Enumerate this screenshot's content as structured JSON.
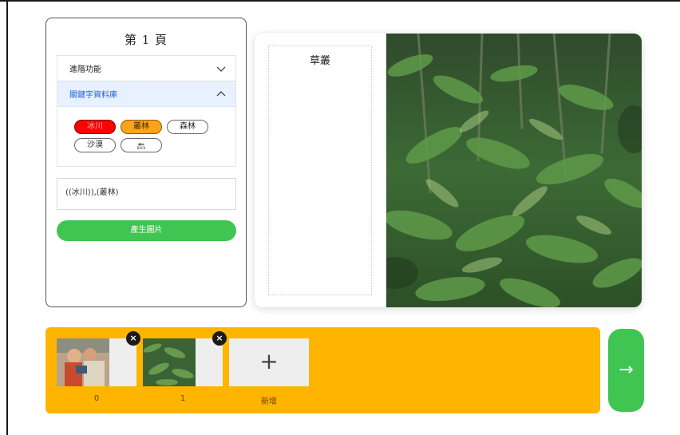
{
  "page": {
    "title": "第 1 頁"
  },
  "accordion": {
    "advanced_label": "進階功能",
    "keywords_label": "關鍵字資料庫"
  },
  "chips": [
    {
      "label": "冰川",
      "state": "red"
    },
    {
      "label": "叢林",
      "state": "orange"
    },
    {
      "label": "森林",
      "state": "plain"
    },
    {
      "label": "沙漠",
      "state": "plain"
    },
    {
      "label": "BACK",
      "glyph": "⇐",
      "state": "plain"
    }
  ],
  "prompt_text": "((冰川)),(叢林)",
  "generate_label": "產生圖片",
  "preview": {
    "text_title": "草叢"
  },
  "thumbnails": [
    {
      "label": "0",
      "close": "×"
    },
    {
      "label": "1",
      "close": "×"
    }
  ],
  "add_tile": {
    "symbol": "+",
    "label": "新增"
  },
  "next_arrow": "→",
  "colors": {
    "strip": "#ffb400",
    "green_button": "#41c552",
    "chip_red": "#ff0000",
    "chip_orange": "#ffa31a",
    "accent_blue": "#1c64d8"
  }
}
